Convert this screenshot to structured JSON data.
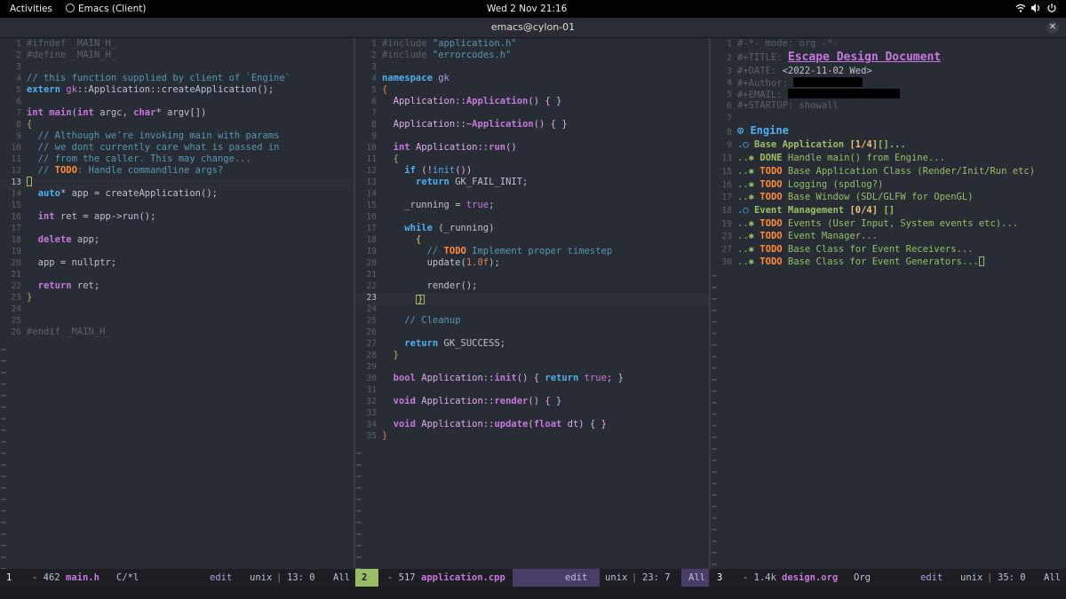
{
  "topbar": {
    "activities": "Activities",
    "app": "Emacs (Client)",
    "clock": "Wed 2 Nov  21:16"
  },
  "window": {
    "title": "emacs@cylon-01"
  },
  "pane1": {
    "line_numbers": [
      "1",
      "2",
      "3",
      "4",
      "5",
      "6",
      "7",
      "8",
      "9",
      "10",
      "11",
      "12",
      "13",
      "14",
      "15",
      "16",
      "17",
      "18",
      "19",
      "20",
      "21",
      "22",
      "23",
      "24",
      "25",
      "26"
    ],
    "current_line": "13",
    "modeline": {
      "number": "1",
      "size": "- 462",
      "file": "main.h",
      "mode": "C/*l",
      "state": "edit",
      "encoding": "unix",
      "position": "13: 0",
      "scroll": "All"
    }
  },
  "pane2": {
    "line_numbers": [
      "1",
      "2",
      "3",
      "4",
      "5",
      "6",
      "7",
      "8",
      "9",
      "10",
      "11",
      "12",
      "13",
      "14",
      "15",
      "16",
      "17",
      "18",
      "19",
      "20",
      "21",
      "22",
      "23",
      "24",
      "25",
      "26",
      "27",
      "28",
      "29",
      "30",
      "31",
      "32",
      "33",
      "34",
      "35"
    ],
    "current_line": "23",
    "modeline": {
      "number": "2",
      "size": "- 517",
      "file": "application.cpp",
      "state": "edit",
      "encoding": "unix",
      "position": "23: 7",
      "scroll": "All"
    }
  },
  "pane3": {
    "line_numbers": [
      "1",
      "2",
      "3",
      "4",
      "5",
      "6",
      "7",
      "8",
      "9",
      "13",
      "15",
      "16",
      "17",
      "18",
      "19",
      "23",
      "27",
      "30"
    ],
    "modeline": {
      "number": "3",
      "size": "- 1.4k",
      "file": "design.org",
      "mode": "Org",
      "state": "edit",
      "encoding": "unix",
      "position": "35: 0",
      "scroll": "All"
    }
  },
  "code": {
    "l1": [
      "#ifndef _MAIN_H_",
      "#define _MAIN_H_",
      "",
      "// this function supplied by client of `Engine`",
      "extern",
      " gk",
      "::Application::createApplication();",
      "",
      "int",
      " main",
      "(",
      "int",
      " argc, ",
      "char",
      "* argv[])",
      "{",
      "// Although we're invoking main with params",
      "// we dont currently care what is passed in",
      "// from the caller. This may change...",
      "// ",
      "TODO",
      ": Handle commandline args?",
      "auto",
      "* app = createApplication();",
      "int",
      " ret = app->run();",
      "delete",
      " app;",
      "app = nullptr;",
      "return",
      " ret;",
      "}",
      "#endif _MAIN_H_"
    ],
    "l2": [
      "#include ",
      "\"application.h\"",
      "#include ",
      "\"errorcodes.h\"",
      "namespace",
      " gk",
      "{",
      "Application::",
      "Application",
      "() { }",
      "Application::~",
      "Application",
      "() { }",
      "int",
      " Application::",
      "run",
      "()",
      "{",
      "if",
      " (!",
      "init",
      "())",
      "return",
      " GK_FAIL_INIT;",
      "_running = ",
      "true",
      ";",
      "while",
      " (_running)",
      "{",
      "// ",
      "TODO",
      " Implement proper timestep",
      "update",
      "(",
      "1.0f",
      ");",
      "render",
      "();",
      "}",
      "// Cleanup",
      "return",
      " GK_SUCCESS;",
      "}",
      "bool",
      " Application::",
      "init",
      "() { ",
      "return",
      " true",
      "; }",
      "void",
      " Application::",
      "render",
      "() { }",
      "void",
      " Application::",
      "update",
      "(",
      "float",
      " dt) { }",
      "}"
    ],
    "l3": [
      "#-*- mode: org -*-",
      "#+TITLE: ",
      "Escape Design Document",
      "#+DATE: ",
      "<2022-11-02 Wed>",
      "#+Author: ",
      "#+EMAIL: ",
      "#+STARTUP: showall",
      "⊙ ",
      "Engine",
      ".○ ",
      "Base Application ",
      "[1/4]",
      "[]...",
      "..✱ ",
      "DONE",
      " Handle main() from Engine...",
      "..✱ ",
      "TODO",
      " Base Application Class (Render/Init/Run etc)",
      "..✱ ",
      "TODO",
      " Logging (spdlog?)",
      "..✱ ",
      "TODO",
      " Base Window (SDL/GLFW for OpenGL)",
      ".○ ",
      "Event Management ",
      "[0/4]",
      " []",
      "..✱ ",
      "TODO",
      " Events (User Input, System events etc)...",
      "..✱ ",
      "TODO",
      " Event Manager...",
      "..✱ ",
      "TODO",
      " Base Class for Event Receivers...",
      "..✱ ",
      "TODO",
      " Base Class for Event Generators..."
    ]
  },
  "tilde": "~",
  "colors": {
    "background": "#282c34",
    "modeline": "#1c1e24",
    "active_badge": "#98be65",
    "accent": "#c678dd",
    "todo": "#ff8c3a",
    "string": "#98be65",
    "comment": "#5699af"
  }
}
